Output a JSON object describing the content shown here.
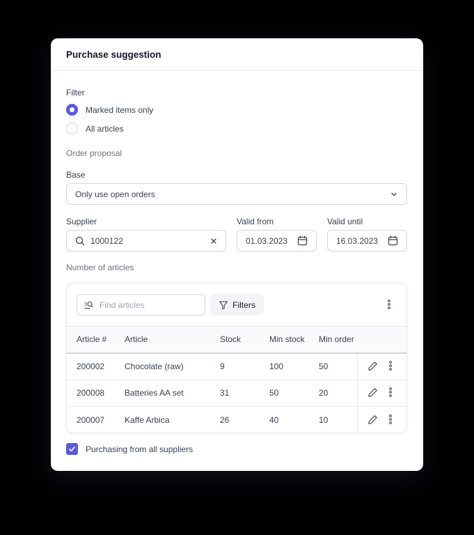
{
  "dialog": {
    "title": "Purchase suggestion"
  },
  "filter": {
    "label": "Filter",
    "options": [
      {
        "label": "Marked items only",
        "selected": true
      },
      {
        "label": "All articles",
        "selected": false
      }
    ]
  },
  "order_proposal": {
    "label": "Order proposal",
    "base_label": "Base",
    "base_value": "Only use open orders"
  },
  "supplier": {
    "label": "Supplier",
    "value": "1000122"
  },
  "valid_from": {
    "label": "Valid from",
    "value": "01.03.2023"
  },
  "valid_until": {
    "label": "Valid until",
    "value": "16.03.2023"
  },
  "articles": {
    "label": "Number of articles",
    "search_placeholder": "Find articles",
    "filters_label": "Filters",
    "columns": [
      "Article #",
      "Article",
      "Stock",
      "Min stock",
      "Min order"
    ],
    "rows": [
      [
        "200002",
        "Chocolate (raw)",
        "9",
        "100",
        "50"
      ],
      [
        "200008",
        "Batteries AA set",
        "31",
        "50",
        "20"
      ],
      [
        "200007",
        "Kaffe Arbica",
        "26",
        "40",
        "10"
      ]
    ]
  },
  "all_suppliers": {
    "label": "Purchasing from all suppliers",
    "checked": true
  },
  "colors": {
    "accent": "#5b5bd6"
  }
}
